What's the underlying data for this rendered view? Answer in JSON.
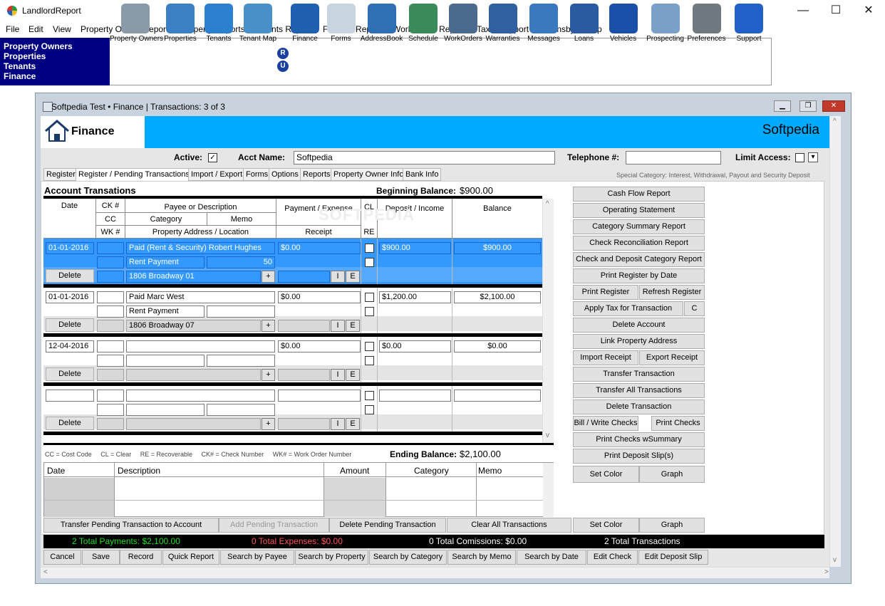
{
  "app": {
    "title": "LandlordReport"
  },
  "window_controls": {
    "min": "—",
    "max": "☐",
    "close": "✕"
  },
  "menu": [
    "File",
    "Edit",
    "View",
    "Property Owner Reports",
    "Property Reports",
    "Tenants Reports",
    "Finance Reports",
    "Work Order Reports",
    "Tax",
    "Support",
    "MDansby",
    "Help"
  ],
  "nav": [
    "Property Owners",
    "Properties",
    "Tenants",
    "Finance"
  ],
  "toolbar": [
    {
      "label": "Property Owners",
      "icon": "building-icon",
      "color": "#8a9aa8"
    },
    {
      "label": "Properties",
      "icon": "houses-icon",
      "color": "#3b7fc4"
    },
    {
      "label": "Tenants",
      "icon": "people-icon",
      "color": "#2d7fd0"
    },
    {
      "label": "Tenant Map",
      "icon": "magnifier-globe-icon",
      "color": "#4a90c8"
    },
    {
      "label": "Finance",
      "icon": "bank-icon",
      "color": "#2060b0"
    },
    {
      "label": "Forms",
      "icon": "forms-icon",
      "color": "#c8d4e0"
    },
    {
      "label": "AddressBook",
      "icon": "address-book-icon",
      "color": "#2f6fb4"
    },
    {
      "label": "Schedule",
      "icon": "schedule-icon",
      "color": "#3a8a5a"
    },
    {
      "label": "WorkOrders",
      "icon": "tools-icon",
      "color": "#4a6a90"
    },
    {
      "label": "Warranties",
      "icon": "warranty-badge-icon",
      "color": "#3060a0"
    },
    {
      "label": "Messages",
      "icon": "telephone-icon",
      "color": "#3a78c0"
    },
    {
      "label": "Loans",
      "icon": "hourglass-icon",
      "color": "#2a5aa0"
    },
    {
      "label": "Vehicles",
      "icon": "car-icon",
      "color": "#1a50a8"
    },
    {
      "label": "Prospecting",
      "icon": "skyscraper-icon",
      "color": "#7aa0c8"
    },
    {
      "label": "Preferences",
      "icon": "wrench-screwdriver-icon",
      "color": "#707880"
    },
    {
      "label": "Support",
      "icon": "question-icon",
      "color": "#2060c8"
    }
  ],
  "ru": [
    "R",
    "U"
  ],
  "child": {
    "title": "Softpedia Test  •  Finance | Transactions: 3 of 3"
  },
  "header": {
    "section": "Finance",
    "name": "Softpedia"
  },
  "account": {
    "active_label": "Active:",
    "acct_label": "Acct Name:",
    "acct_value": "Softpedia",
    "tel_label": "Telephone #:",
    "limit_label": "Limit Access:",
    "active_mark": "✓",
    "dropdown": "▾"
  },
  "tabs": [
    "Register",
    "Register / Pending Transactions",
    "Import / Export",
    "Forms",
    "Options",
    "Reports",
    "Property Owner Info",
    "Bank Info"
  ],
  "special": "Special Category:  Interest, Withdrawal, Payout and Security Deposit",
  "register": {
    "title": "Account Transations",
    "begin_label": "Beginning Balance:",
    "begin_value": "$900.00",
    "end_label": "Ending Balance:",
    "end_value": "$2,100.00",
    "cols": {
      "date": "Date",
      "ck": "CK #",
      "cc": "CC",
      "wk": "WK #",
      "payee": "Payee or Description",
      "category": "Category",
      "memo": "Memo",
      "address": "Property Address / Location",
      "payment": "Payment / Expense",
      "receipt": "Receipt",
      "cl": "CL",
      "re": "RE",
      "deposit": "Deposit / Income",
      "balance": "Balance"
    },
    "legend": "CC = Cost Code     CL = Clear     RE = Recoverable     CK# = Check Number     WK# = Work Order Number",
    "delete": "Delete",
    "plus": "+",
    "i": "I",
    "e": "E",
    "rows": [
      {
        "date": "01-01-2016",
        "payee": "Paid (Rent & Security) Robert Hughes",
        "payment": "$0.00",
        "deposit": "$900.00",
        "balance": "$900.00",
        "category": "Rent Payment",
        "memo": "50",
        "address": "1806 Broadway 01",
        "selected": true
      },
      {
        "date": "01-01-2016",
        "payee": "Paid Marc West",
        "payment": "$0.00",
        "deposit": "$1,200.00",
        "balance": "$2,100.00",
        "category": "Rent Payment",
        "memo": "",
        "address": "1806 Broadway 07",
        "selected": false
      },
      {
        "date": "12-04-2016",
        "payee": "",
        "payment": "$0.00",
        "deposit": "$0.00",
        "balance": "$0.00",
        "category": "",
        "memo": "",
        "address": "",
        "selected": false
      },
      {
        "date": "",
        "payee": "",
        "payment": "",
        "deposit": "",
        "balance": "",
        "category": "",
        "memo": "",
        "address": "",
        "selected": false
      }
    ]
  },
  "pending": {
    "cols": [
      "Date",
      "Description",
      "Amount",
      "Category",
      "Memo"
    ]
  },
  "side_buttons": [
    "Cash Flow Report",
    "Operating Statement",
    "Category Summary Report",
    "Check Reconciliation Report",
    "Check and Deposit Category Report",
    "Print Register by Date",
    "Print Register",
    "Refresh Register",
    "Apply Tax for Transaction",
    "C",
    "Delete Account",
    "Link Property Address",
    "Import Receipt",
    "Export Receipt",
    "Transfer Transaction",
    "Transfer All Transactions",
    "Delete Transaction",
    "Bill / Write Checks",
    "Print Checks",
    "Print Checks wSummary",
    "Print Deposit Slip(s)",
    "Set Color",
    "Graph"
  ],
  "pending_buttons": [
    "Transfer Pending Transaction to Account",
    "Add Pending Transaction",
    "Delete Pending Transaction",
    "Clear All Transactions",
    "Set Color",
    "Graph"
  ],
  "status": {
    "payments": "2 Total Payments: $2,100.00",
    "expenses": "0 Total Expenses: $0.00",
    "commissions": "0 Total Comissions: $0.00",
    "transactions": "2 Total Transactions",
    "colors": {
      "payments": "#22dd22",
      "expenses": "#ff5555",
      "white": "#ffffff"
    }
  },
  "bottom_buttons": [
    "Cancel",
    "Save",
    "Record",
    "Quick Report",
    "Search by Payee",
    "Search by Property",
    "Search by Category",
    "Search by Memo",
    "Search by Date",
    "Edit Check",
    "Edit Deposit Slip"
  ],
  "scroll": {
    "up": "^",
    "down": "v",
    "left": "<",
    "right": ">"
  },
  "watermark": "SOFTPEDIA"
}
